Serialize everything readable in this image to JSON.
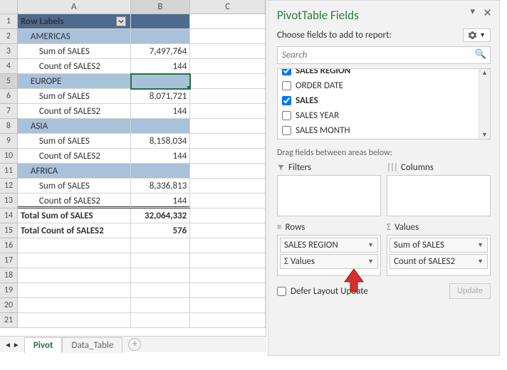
{
  "columns": {
    "A": "A",
    "B": "B",
    "C": "C"
  },
  "header": {
    "label": "Row Labels"
  },
  "groups": [
    {
      "name": "AMERICAS",
      "sum_label": "Sum of SALES",
      "sum": "7,497,764",
      "count_label": "Count of SALES2",
      "count": "144"
    },
    {
      "name": "EUROPE",
      "sum_label": "Sum of SALES",
      "sum": "8,071,721",
      "count_label": "Count of SALES2",
      "count": "144"
    },
    {
      "name": "ASIA",
      "sum_label": "Sum of SALES",
      "sum": "8,158,034",
      "count_label": "Count of SALES2",
      "count": "144"
    },
    {
      "name": "AFRICA",
      "sum_label": "Sum of SALES",
      "sum": "8,336,813",
      "count_label": "Count of SALES2",
      "count": "144"
    }
  ],
  "totals": {
    "sum_label": "Total Sum of SALES",
    "sum": "32,064,332",
    "count_label": "Total Count of SALES2",
    "count": "576"
  },
  "tabs": {
    "active": "Pivot",
    "other": "Data_Table"
  },
  "panel": {
    "title": "PivotTable Fields",
    "sub": "Choose fields to add to report:",
    "search_ph": "Search",
    "fields": [
      {
        "label": "SALES REGION",
        "checked": true,
        "bold": true
      },
      {
        "label": "ORDER DATE",
        "checked": false
      },
      {
        "label": "SALES",
        "checked": true,
        "bold": true
      },
      {
        "label": "SALES YEAR",
        "checked": false
      },
      {
        "label": "SALES MONTH",
        "checked": false
      }
    ],
    "drag": "Drag fields between areas below:",
    "areas": {
      "filters": "Filters",
      "columns": "Columns",
      "rows": "Rows",
      "values": "Values"
    },
    "rows_chips": [
      "SALES REGION",
      "Σ Values"
    ],
    "values_chips": [
      "Sum of SALES",
      "Count of SALES2"
    ],
    "defer": "Defer Layout Update",
    "update": "Update"
  }
}
